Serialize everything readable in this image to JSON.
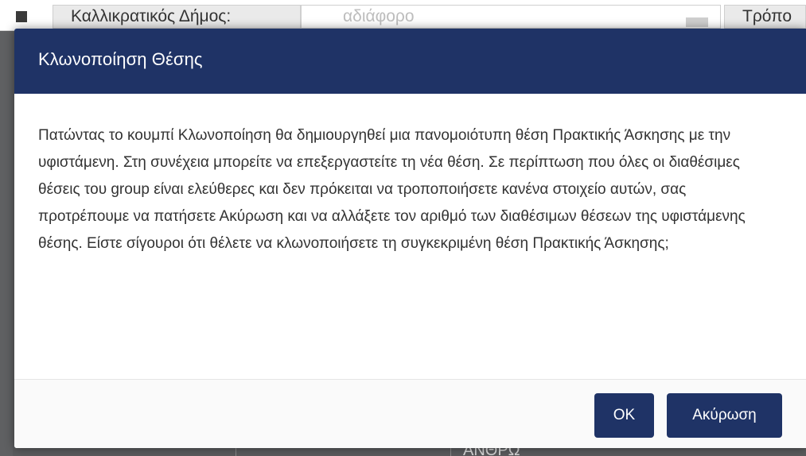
{
  "background": {
    "row_label": "Καλλικρατικός Δήμος:",
    "row_placeholder": "αδιάφορο",
    "row_label_2": "Τρόπο",
    "bottom_text": "ΑΝΘΡΩ"
  },
  "modal": {
    "title": "Κλωνοποίηση Θέσης",
    "message": "Πατώντας το κουμπί Κλωνοποίηση θα δημιουργηθεί μια πανομοιότυπη θέση Πρακτικής Άσκησης με την υφιστάμενη. Στη συνέχεια μπορείτε να επεξεργαστείτε τη νέα θέση. Σε περίπτωση που όλες οι διαθέσιμες θέσεις του group είναι ελεύθερες και δεν πρόκειται να τροποποιήσετε κανένα στοιχείο αυτών, σας προτρέπουμε να πατήσετε Ακύρωση και να αλλάξετε τον αριθμό των διαθέσιμων θέσεων της υφιστάμενης θέσης. Είστε σίγουροι ότι θέλετε να κλωνοποιήσετε τη συγκεκριμένη θέση Πρακτικής Άσκησης;",
    "ok_label": "OK",
    "cancel_label": "Ακύρωση"
  },
  "colors": {
    "header_bg": "#1f3366",
    "button_bg": "#1f3366",
    "overlay": "#5f6062"
  }
}
